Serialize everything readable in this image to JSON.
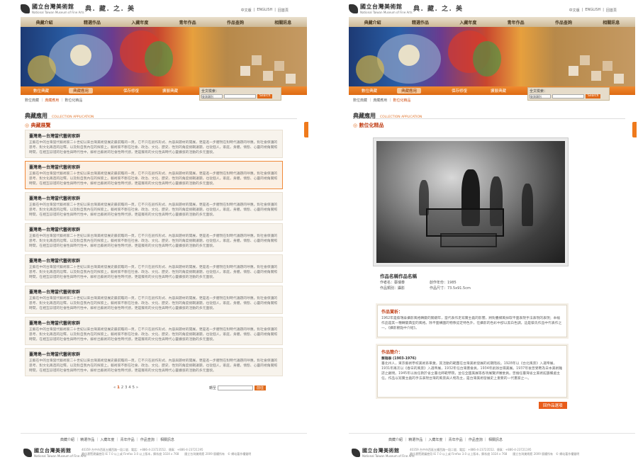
{
  "header": {
    "logo_cn": "國立台灣美術館",
    "logo_en": "National Taiwan Museum of Fine Arts",
    "slogan": "典．藏．之．美",
    "top_links": [
      "中文版",
      "ENGLISH",
      "回首頁"
    ]
  },
  "nav": [
    "典藏介紹",
    "精選作品",
    "入藏年度",
    "青年作品",
    "作品查詢",
    "相關訊息"
  ],
  "subnav": [
    "數位典藏",
    "典藏應用",
    "保存修復",
    "擴展典藏"
  ],
  "search": {
    "label": "全文檢索：",
    "select": "查詢類別",
    "button": "Search"
  },
  "left": {
    "breadcrumb": [
      "數位典藏",
      "典藏應用",
      "數位化精品"
    ],
    "title": "典藏應用",
    "title_en": "COLLECTION APPLICATION",
    "section": "典藏展覽",
    "cards": [
      {
        "title": "臺灣島—台灣當代藝術家群",
        "desc": "正藝在中的台灣當代藝術家二十世紀以來台灣美術發展史最前瞻的一頁，它不只在創作形式、內容與題材的開展，更是進一步體現在對時代議題的呼應。對社會保護的思考、對文化再造的詮釋，以及對自我內在的探索上。藝術家不斷在社會、政治、文化、歷史、性別的角度挑戰議題，也從個人，家庭，身體，情慾、心靈的視角關照時間，在相互辯證的社會性與時代性中，解析出藝術的社會性時代感，更是獨有的文化性與時代心靈擴張的活動的多元面貌。"
      },
      {
        "title": "臺灣島—台灣當代藝術家群",
        "desc": "正藝在中的台灣當代藝術家二十世紀以來台灣美術發展史最前瞻的一頁，它不只在創作形式、內容與題材的開展，更是進一步體現在對時代議題的呼應。對社會保護的思考、對文化再造的詮釋，以及對自我內在的探索上。藝術家不斷在社會、政治、文化、歷史、性別的角度挑戰議題，也從個人，家庭，身體，情慾、心靈的視角關照時間，在相互辯證的社會性與時代性中，解析出藝術的社會性時代感，更是獨有的文化性與時代心靈擴張的活動的多元面貌。"
      },
      {
        "title": "臺灣島—台灣當代藝術家群",
        "desc": "正藝在中的台灣當代藝術家二十世紀以來台灣美術發展史最前瞻的一頁，它不只在創作形式、內容與題材的開展，更是進一步體現在對時代議題的呼應。對社會保護的思考、對文化再造的詮釋，以及對自我內在的探索上。藝術家不斷在社會、政治、文化、歷史、性別的角度挑戰議題，也從個人，家庭，身體，情慾、心靈的視角關照時間，在相互辯證的社會性與時代性中，解析出藝術的社會性時代感，更是獨有的文化性與時代心靈擴張的活動的多元面貌。"
      },
      {
        "title": "臺灣島—台灣當代藝術家群",
        "desc": "正藝在中的台灣當代藝術家二十世紀以來台灣美術發展史最前瞻的一頁，它不只在創作形式、內容與題材的開展，更是進一步體現在對時代議題的呼應。對社會保護的思考、對文化再造的詮釋，以及對自我內在的探索上。藝術家不斷在社會、政治、文化、歷史、性別的角度挑戰議題，也從個人，家庭，身體，情慾、心靈的視角關照時間，在相互辯證的社會性與時代性中，解析出藝術的社會性時代感，更是獨有的文化性與時代心靈擴張的活動的多元面貌。"
      },
      {
        "title": "臺灣島—台灣當代藝術家群",
        "desc": "正藝在中的台灣當代藝術家二十世紀以來台灣美術發展史最前瞻的一頁，它不只在創作形式、內容與題材的開展，更是進一步體現在對時代議題的呼應。對社會保護的思考、對文化再造的詮釋，以及對自我內在的探索上。藝術家不斷在社會、政治、文化、歷史、性別的角度挑戰議題，也從個人，家庭，身體，情慾、心靈的視角關照時間，在相互辯證的社會性與時代性中，解析出藝術的社會性時代感，更是獨有的文化性與時代心靈擴張的活動的多元面貌。"
      },
      {
        "title": "臺灣島—台灣當代藝術家群",
        "desc": "正藝在中的台灣當代藝術家二十世紀以來台灣美術發展史最前瞻的一頁，它不只在創作形式、內容與題材的開展，更是進一步體現在對時代議題的呼應。對社會保護的思考、對文化再造的詮釋，以及對自我內在的探索上。藝術家不斷在社會、政治、文化、歷史、性別的角度挑戰議題，也從個人，家庭，身體，情慾、心靈的視角關照時間，在相互辯證的社會性與時代性中，解析出藝術的社會性時代感，更是獨有的文化性與時代心靈擴張的活動的多元面貌。"
      },
      {
        "title": "臺灣島—台灣當代藝術家群",
        "desc": "正藝在中的台灣當代藝術家二十世紀以來台灣美術發展史最前瞻的一頁，它不只在創作形式、內容與題材的開展，更是進一步體現在對時代議題的呼應。對社會保護的思考、對文化再造的詮釋，以及對自我內在的探索上。藝術家不斷在社會、政治、文化、歷史、性別的角度挑戰議題，也從個人，家庭，身體，情慾、心靈的視角關照時間，在相互辯證的社會性與時代性中，解析出藝術的社會性時代感，更是獨有的文化性與時代心靈擴張的活動的多元面貌。"
      },
      {
        "title": "臺灣島—台灣當代藝術家群",
        "desc": "正藝在中的台灣當代藝術家二十世紀以來台灣美術發展史最前瞻的一頁，它不只在創作形式、內容與題材的開展，更是進一步體現在對時代議題的呼應。對社會保護的思考、對文化再造的詮釋，以及對自我內在的探索上。藝術家不斷在社會、政治、文化、歷史、性別的角度挑戰議題，也從個人，家庭，身體，情慾、心靈的視角關照時間，在相互辯證的社會性與時代性中，解析出藝術的社會性時代感，更是獨有的文化性與時代心靈擴張的活動的多元面貌。"
      }
    ],
    "pager": [
      "«",
      "1",
      "2",
      "3",
      "4",
      "5",
      "»"
    ],
    "pager_label": "轉至",
    "pager_go": "前往"
  },
  "right": {
    "breadcrumb": [
      "數位典藏",
      "典藏應用",
      "數位化精品"
    ],
    "title": "典藏應用",
    "title_en": "COLLECTION APPLICATION",
    "section": "數位化精品",
    "work_title": "作品名稱作品名稱",
    "meta": [
      [
        "作者名：蔡瑞泰",
        "創作年份：1985"
      ],
      [
        "作品類別：攝影",
        "作品尺寸：73.5x91.5cm"
      ]
    ],
    "desc_head": "作品賞析：",
    "desc_body": "1962年是蔡瑞泰攝影風格轉變的關鍵年，當代表作走寫實主義的影響，將對疊鄉風採取平面表現手法表現的表現；本幅作品是其一種轉變典型的風格。除平面構圖的物像認定特色外，在攝影的色彩中卻以黑白色調，這是蔡氏作品中代表作之一。《攝影觀點中介紹》。",
    "bio_head": "作品簡介：",
    "bio_name": "蔡瑞泰 (1903-1976)",
    "bio_body": "臺北州人，東京藝術學校美術系畢業，其活動的範圍在台灣美術發展的初期階段。1928年以《台北風景》入選帝展，1931年再次以《春日的風景》入選帝展，1932年任台灣畫會員，1934年創辦台陽美展。1937年後曾受聘為日本美術雜誌之顧問。1945年以後任教於省立臺北師範學院，並任全國美展等各項展覽評審委員。曾擔任臺灣省立美術館籌備處主任。作品以寫實主義的手法表現台灣的風景與人物為主，是台灣美術發展史上重要的一代畫家之一。",
    "back": "回作品選項"
  },
  "footer": {
    "links": [
      "典藏介紹",
      "精選作品",
      "入藏年度",
      "青年作品",
      "作品查詢",
      "相關訊息"
    ],
    "logo_cn": "國立台灣美術館",
    "logo_en": "National Taiwan Museum of Fine Arts",
    "addr1": "40359 台中市西區五權西路一段二號．電話：+886-4-23723552．傳真：+886-4-23721195",
    "addr2": "最佳瀏覽建議使用 IE 7.0 以上或 Firefox 3.0 以上版本，解析度 1024 x 768　　國立台灣美術館 2009 版權所有　© 網站著作權聲明"
  }
}
